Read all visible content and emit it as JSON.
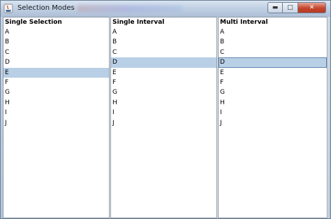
{
  "window": {
    "title": "Selection Modes",
    "minimize_icon": "minimize-icon",
    "maximize_icon": "maximize-icon",
    "close_icon": "close-icon"
  },
  "columns": [
    {
      "header": "Single Selection",
      "items": [
        "A",
        "B",
        "C",
        "D",
        "E",
        "F",
        "G",
        "H",
        "I",
        "J"
      ],
      "selected": [
        "E"
      ]
    },
    {
      "header": "Single Interval",
      "items": [
        "A",
        "B",
        "C",
        "D",
        "E",
        "F",
        "G",
        "H",
        "I",
        "J"
      ],
      "selected": [
        "D"
      ]
    },
    {
      "header": "Multi Interval",
      "items": [
        "A",
        "B",
        "C",
        "D",
        "E",
        "F",
        "G",
        "H",
        "I",
        "J"
      ],
      "selected": [
        "D"
      ],
      "focused": "D"
    }
  ],
  "colors": {
    "selection": "#b8cfe5",
    "focus_border": "#6388b4"
  }
}
